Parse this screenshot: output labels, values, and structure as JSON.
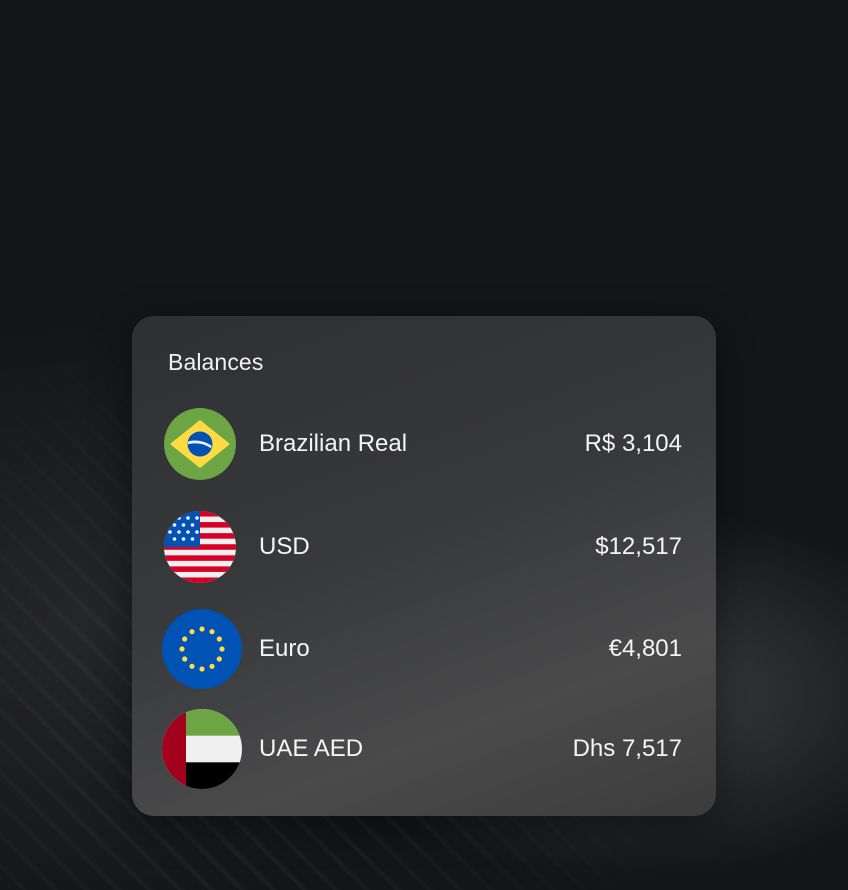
{
  "balances": {
    "title": "Balances",
    "items": [
      {
        "currency": "Brazilian Real",
        "amount": "R$ 3,104",
        "flag_icon": "brazil-flag-icon"
      },
      {
        "currency": "USD",
        "amount": "$12,517",
        "flag_icon": "usa-flag-icon"
      },
      {
        "currency": "Euro",
        "amount": "€4,801",
        "flag_icon": "eu-flag-icon"
      },
      {
        "currency": "UAE AED",
        "amount": "Dhs 7,517",
        "flag_icon": "uae-flag-icon"
      }
    ]
  },
  "colors": {
    "background": "#141517",
    "card": "#38393b",
    "text": "#f4f4f4"
  }
}
